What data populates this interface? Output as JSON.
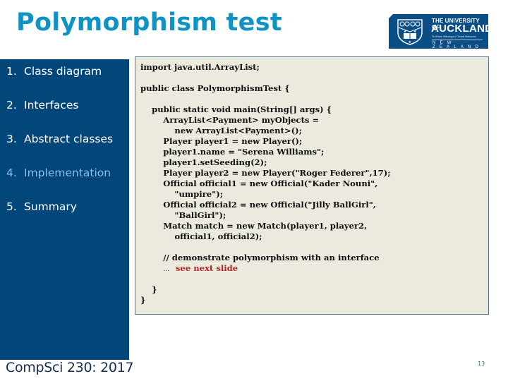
{
  "slide": {
    "title": "Polymorphism test",
    "logo": {
      "line1": "THE UNIVERSITY OF",
      "line2": "AUCKLAND",
      "line3": "Te Whare Wānanga o Tāmaki Makaurau",
      "line4": "NEW ZEALAND",
      "background": "#0b4e86"
    },
    "sidebar": {
      "items": [
        {
          "number": "1.",
          "label": "Class diagram",
          "active": false
        },
        {
          "number": "2.",
          "label": "Interfaces",
          "active": false
        },
        {
          "number": "3.",
          "label": "Abstract classes",
          "active": false
        },
        {
          "number": "4.",
          "label": "Implementation",
          "active": true
        },
        {
          "number": "5.",
          "label": "Summary",
          "active": false
        }
      ],
      "background": "#02467a",
      "active_color": "#8dbbef"
    },
    "code": {
      "lines": [
        "import java.util.ArrayList;",
        "",
        "public class PolymorphismTest {",
        "",
        "    public static void main(String[] args) {",
        "        ArrayList<Payment> myObjects =",
        "            new ArrayList<Payment>();",
        "        Player player1 = new Player();",
        "        player1.name = \"Serena Williams\";",
        "        player1.setSeeding(2);",
        "        Player player2 = new Player(\"Roger Federer\",17);",
        "        Official official1 = new Official(\"Kader Nouni\",",
        "            \"umpire\");",
        "        Official official2 = new Official(\"Jilly BallGirl\",",
        "            \"BallGirl\");",
        "        Match match = new Match(player1, player2,",
        "            official1, official2);",
        "",
        "        // demonstrate polymorphism with an interface",
        "        ",
        "",
        "    }",
        "}"
      ],
      "ellipsis": "…",
      "highlight": "see next slide",
      "highlight_color": "#b32626"
    },
    "footer": "CompSci 230: 2017",
    "page_number": "13",
    "title_color": "#0f93c4"
  }
}
